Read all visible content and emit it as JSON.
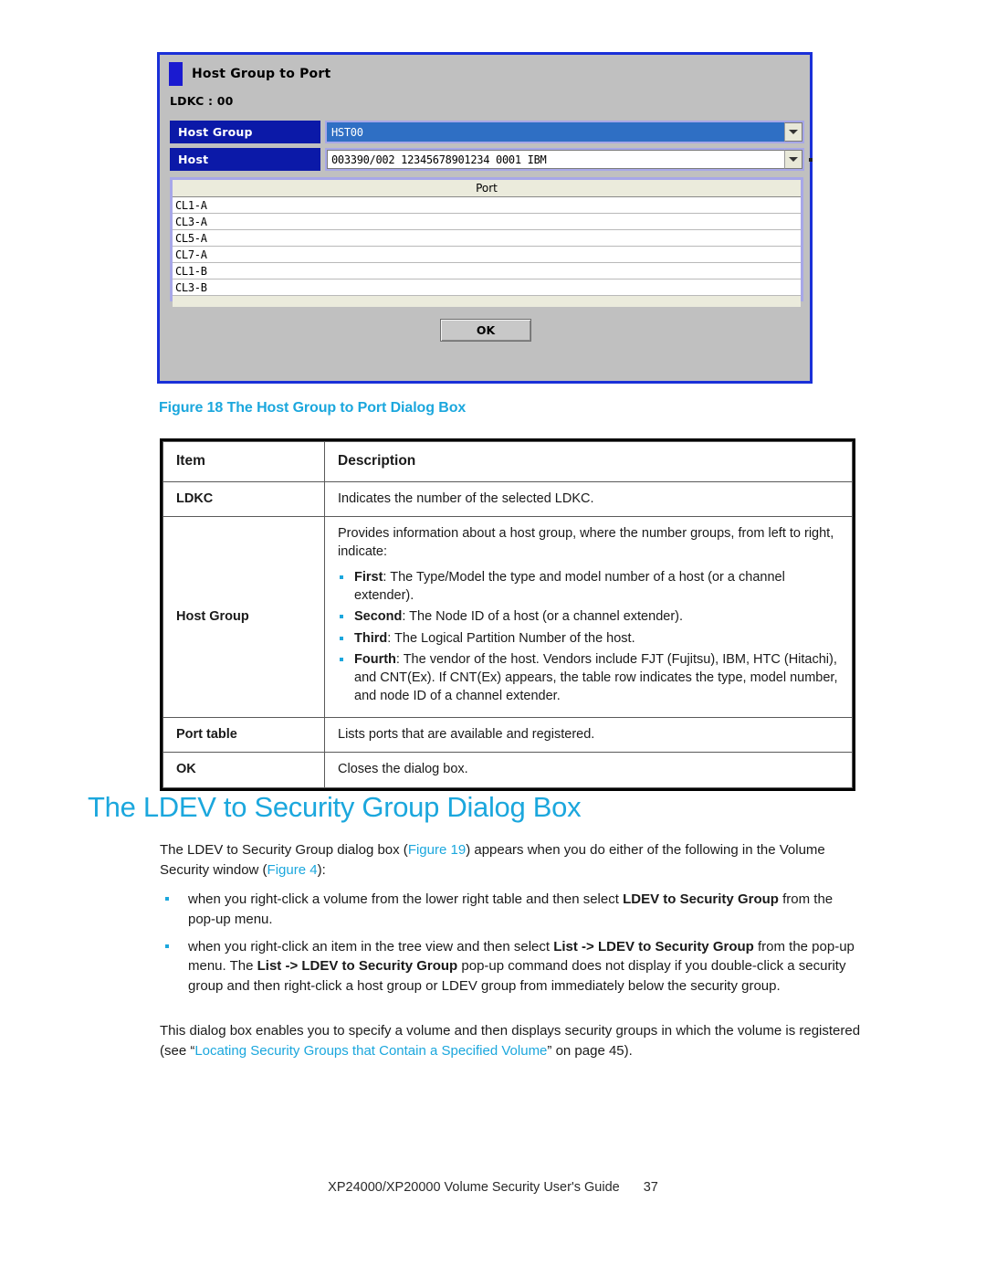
{
  "dialog": {
    "title": "Host Group to Port",
    "ldkc_label": "LDKC : 00",
    "fields": [
      {
        "label": "Host Group",
        "value": "HST00",
        "selected": true
      },
      {
        "label": "Host",
        "value": "003390/002  12345678901234  0001  IBM",
        "selected": false
      }
    ],
    "port_table": {
      "header": "Port",
      "rows": [
        "CL1-A",
        "CL3-A",
        "CL5-A",
        "CL7-A",
        "CL1-B",
        "CL3-B"
      ]
    },
    "ok_label": "OK"
  },
  "figure": {
    "caption": "Figure 18 The Host Group to Port Dialog Box"
  },
  "item_table": {
    "headers": {
      "item": "Item",
      "description": "Description"
    },
    "rows": [
      {
        "item": "LDKC",
        "description": "Indicates the number of the selected LDKC."
      },
      {
        "item": "Host Group",
        "description_intro": "Provides information about a host group, where the number groups, from left to right, indicate:",
        "bullets": [
          {
            "lead": "First",
            "text": ": The Type/Model the type and model number of a host (or a channel extender)."
          },
          {
            "lead": "Second",
            "text": ": The Node ID of a host (or a channel extender)."
          },
          {
            "lead": "Third",
            "text": ": The Logical Partition Number of the host."
          },
          {
            "lead": "Fourth",
            "text": ": The vendor of the host. Vendors include FJT (Fujitsu), IBM, HTC (Hitachi), and CNT(Ex). If CNT(Ex) appears, the table row indicates the type, model number, and node ID of a channel extender."
          }
        ]
      },
      {
        "item": "Port table",
        "description": "Lists ports that are available and registered."
      },
      {
        "item": "OK",
        "description": "Closes the dialog box."
      }
    ]
  },
  "section": {
    "heading": "The LDEV to Security Group Dialog Box",
    "intro": {
      "part1": "The LDEV to Security Group dialog box (",
      "link1": "Figure 19",
      "part2": ") appears when you do either of the following in the Volume Security window (",
      "link2": "Figure 4",
      "part3": "):"
    },
    "bullets": [
      {
        "part1": "when you right-click a volume from the lower right table and then select ",
        "bold1": "LDEV to Security Group",
        "part2": " from the pop-up menu."
      },
      {
        "part1": "when you right-click an item in the tree view and then select ",
        "bold1": "List -> LDEV to Security Group",
        "part2": " from the pop-up menu. The ",
        "bold2": "List -> LDEV to Security Group",
        "part3": " pop-up command does not display if you double-click a security group and then right-click a host group or LDEV group from immediately below the security group."
      }
    ],
    "final": {
      "part1": "This dialog box enables you to specify a volume and then displays security groups in which the volume is registered (see “",
      "link": "Locating Security Groups that Contain a Specified Volume",
      "part2": "” on page 45)."
    }
  },
  "footer": {
    "title": "XP24000/XP20000 Volume Security User's Guide",
    "page": "37"
  }
}
